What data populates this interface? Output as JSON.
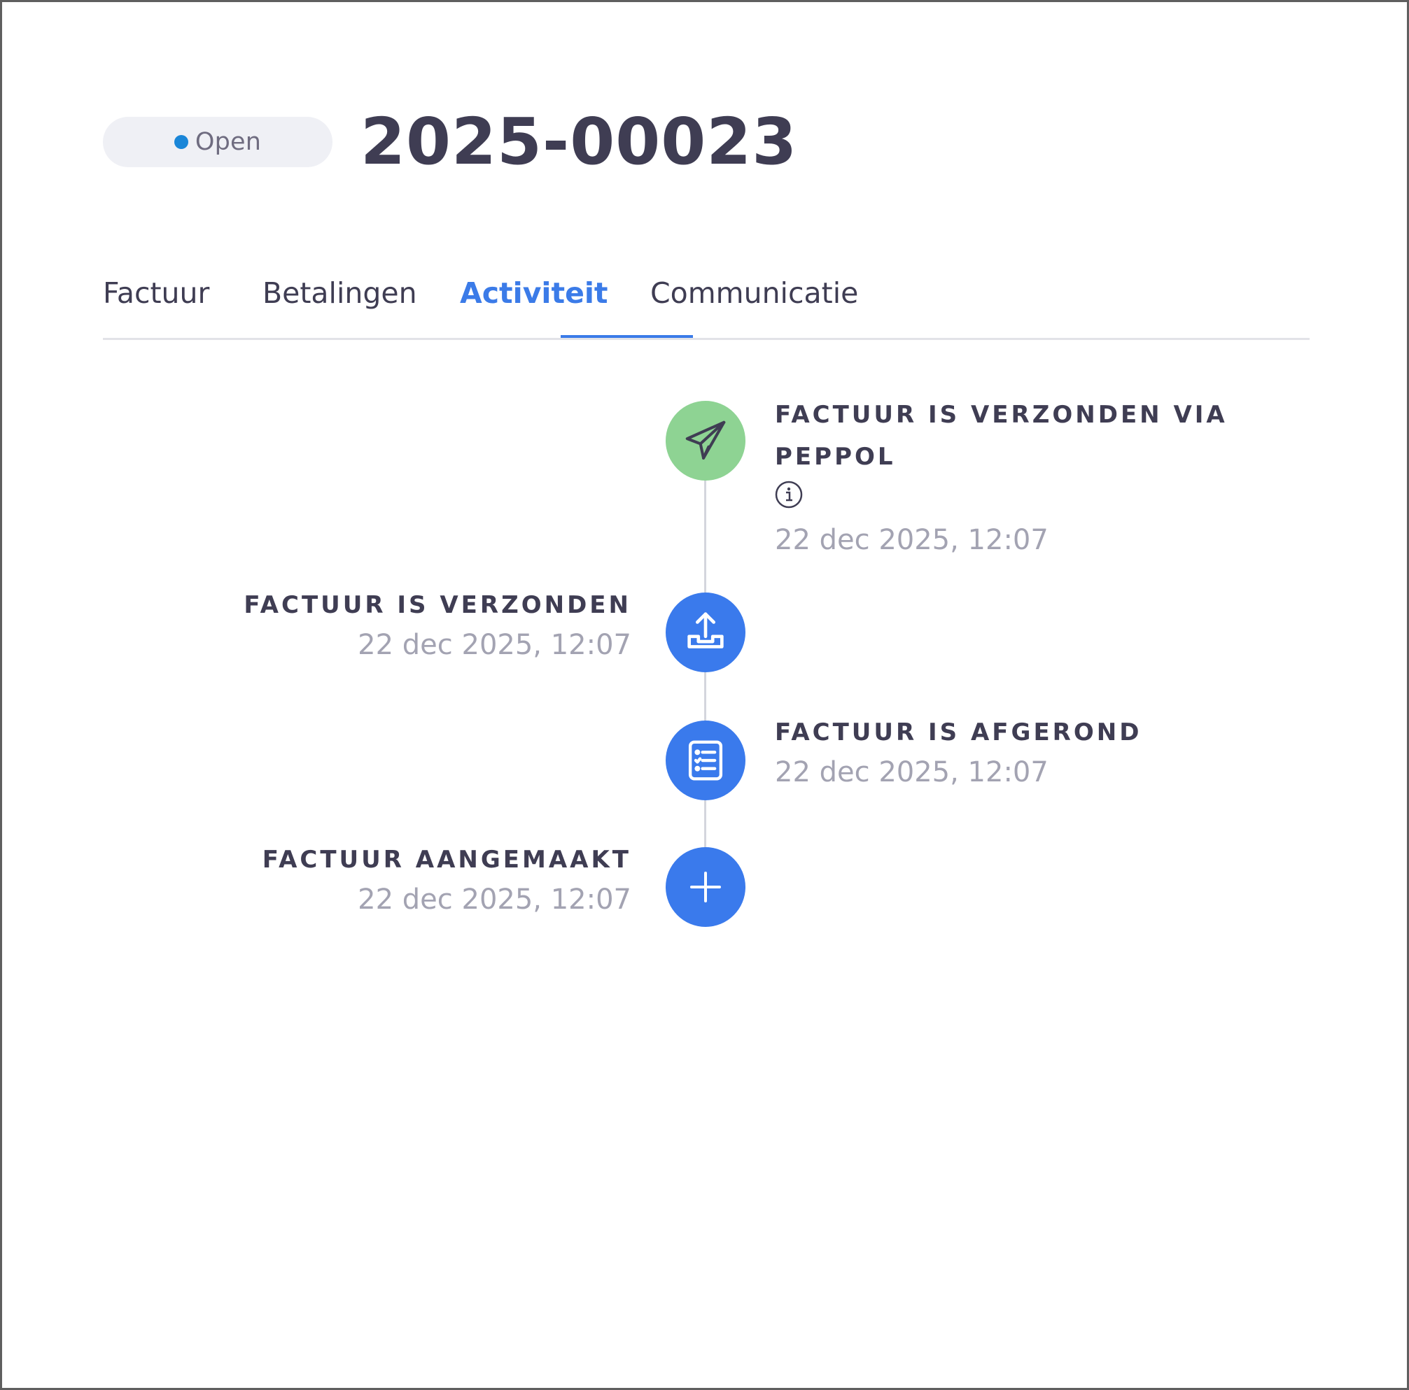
{
  "header": {
    "status_label": "Open",
    "status_color": "#1a86d8",
    "title": "2025-00023"
  },
  "tabs": [
    {
      "label": "Factuur",
      "active": false
    },
    {
      "label": "Betalingen",
      "active": false
    },
    {
      "label": "Activiteit",
      "active": true
    },
    {
      "label": "Communicatie",
      "active": false
    }
  ],
  "timeline": [
    {
      "title_line1": "FACTUUR IS VERZONDEN VIA",
      "title_line2": "PEPPOL",
      "date": "22 dec 2025, 12:07",
      "icon": "paper-plane-icon",
      "color": "#8ed393",
      "has_info": true
    },
    {
      "title": "FACTUUR IS VERZONDEN",
      "date": "22 dec 2025, 12:07",
      "icon": "upload-tray-icon",
      "color": "#3a7aec"
    },
    {
      "title": "FACTUUR IS AFGEROND",
      "date": "22 dec 2025, 12:07",
      "icon": "checklist-icon",
      "color": "#3a7aec"
    },
    {
      "title": "FACTUUR AANGEMAAKT",
      "date": "22 dec 2025, 12:07",
      "icon": "plus-icon",
      "color": "#3a7aec"
    }
  ],
  "colors": {
    "accent": "#3b7be8",
    "text": "#3f3d53",
    "muted": "#a3a3b2"
  }
}
